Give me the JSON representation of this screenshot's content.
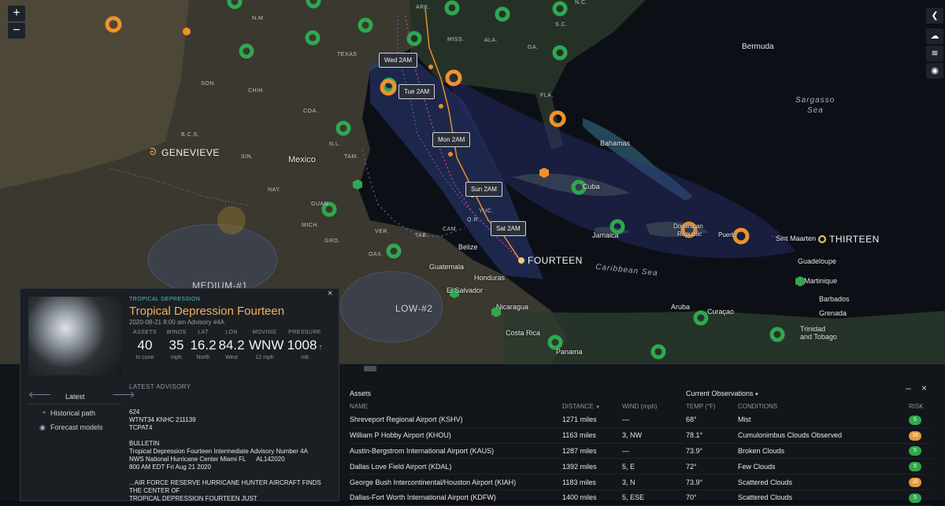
{
  "map": {
    "zoom_in": "+",
    "zoom_out": "−",
    "labels": {
      "ark": "ARK.",
      "nc": "N.C.",
      "nm": "N.M.",
      "miss": "MISS.",
      "ala": "ALA.",
      "sc": "S.C.",
      "ga": "GA.",
      "texas": "TEXAS",
      "fla": "FLA.",
      "son": "SON.",
      "chih": "CHIH.",
      "coa": "COA.",
      "bcs": "B.C.S.",
      "nl": "N.L.",
      "sin": "SIN.",
      "tam": "TAM.",
      "nay": "NAY.",
      "gro": "GRO.",
      "oax": "OAX.",
      "ver": "VER.",
      "mich": "MICH.",
      "tab": "TAB.",
      "cam": "CAM.",
      "qr": "Q.R.",
      "yuc": "YUC.",
      "gto": "GUAN.",
      "mexico": "Mexico",
      "bermuda": "Bermuda",
      "bahamas": "Bahamas",
      "cuba": "Cuba",
      "jamaica": "Jamaica",
      "dominican": "Dominican",
      "republic": "Republic",
      "puerto": "Puerto",
      "sint_maarten": "Sint Maarten",
      "guadeloupe": "Guadeloupe",
      "martinique": "Martinique",
      "barbados": "Barbados",
      "grenada": "Grenada",
      "trinidad": "Trinidad",
      "and_tobago": "and Tobago",
      "aruba": "Aruba",
      "curacao": "Curaçao",
      "belize": "Belize",
      "guatemala": "Guatemala",
      "honduras": "Honduras",
      "el_salvador": "El Salvador",
      "nicaragua": "Nicaragua",
      "costa_rica": "Costa Rica",
      "panama": "Panama",
      "sargasso": "Sargasso",
      "sea": "Sea",
      "caribbean": "Caribbean Sea"
    },
    "storms": {
      "genevieve": "GENEVIEVE",
      "thirteen": "THIRTEEN",
      "fourteen": "FOURTEEN",
      "medium1": "MEDIUM-#1",
      "low2": "LOW-#2"
    },
    "track_times": [
      "Wed 2AM",
      "Tue 2AM",
      "Mon 2AM",
      "Sun 2AM",
      "Sat 2AM"
    ],
    "colors": {
      "green": "#2fa84f",
      "orange": "#f0922c",
      "track_orange": "#e98d2a",
      "track_pink": "#d5468f"
    }
  },
  "storm_panel": {
    "category": "TROPICAL DEPRESSION",
    "title": "Tropical Depression Fourteen",
    "subtitle": "2020-08-21 8:00 am Advisory #4A",
    "stats": [
      {
        "head": "ASSETS",
        "value": "40",
        "unit": "In cone"
      },
      {
        "head": "WINDS",
        "value": "35",
        "unit": "mph"
      },
      {
        "head": "LAT",
        "value": "16.2",
        "unit": "North"
      },
      {
        "head": "LON",
        "value": "84.2",
        "unit": "West"
      },
      {
        "head": "MOVING",
        "value": "WNW",
        "unit": "12 mph"
      },
      {
        "head": "PRESSURE",
        "value": "1008",
        "unit": "mb"
      }
    ],
    "pressure_trend": "↑",
    "nav": {
      "prev": "🡐",
      "label": "Latest",
      "next": "🡒"
    },
    "historical": "Historical path",
    "forecast": "Forecast models",
    "advisory_head": "LATEST ADVISORY",
    "advisory_lines": [
      "624",
      "WTNT34 KNHC 211139",
      "TCPAT4",
      "",
      "BULLETIN",
      "Tropical Depression Fourteen Intermediate Advisory Number 4A",
      "NWS National Hurricane Center Miami FL      AL142020",
      "800 AM EDT Fri Aug 21 2020",
      "",
      "...AIR FORCE RESERVE HURRICANE HUNTER AIRCRAFT FINDS THE CENTER OF",
      "TROPICAL DEPRESSION FOURTEEN JUST"
    ],
    "close": "×"
  },
  "assets": {
    "title": "Assets",
    "obs_title": "Current Observations",
    "columns": [
      "NAME",
      "DISTANCE",
      "WIND (mph)",
      "TEMP (°F)",
      "CONDITIONS",
      "RISK"
    ],
    "rows": [
      {
        "name": "Shreveport Regional Airport (KSHV)",
        "distance": "1271 miles",
        "wind": "—",
        "temp": "68°",
        "conditions": "Mist",
        "risk": "5",
        "risk_color": "#2fa84f"
      },
      {
        "name": "William P Hobby Airport (KHOU)",
        "distance": "1163 miles",
        "wind": "3, NW",
        "temp": "78.1°",
        "conditions": "Cumulonimbus Clouds Observed",
        "risk": "16",
        "risk_color": "#e59a3a"
      },
      {
        "name": "Austin-Bergstrom International Airport (KAUS)",
        "distance": "1287 miles",
        "wind": "—",
        "temp": "73.9°",
        "conditions": "Broken Clouds",
        "risk": "5",
        "risk_color": "#2fa84f"
      },
      {
        "name": "Dallas Love Field Airport (KDAL)",
        "distance": "1392 miles",
        "wind": "5, E",
        "temp": "72°",
        "conditions": "Few Clouds",
        "risk": "5",
        "risk_color": "#2fa84f"
      },
      {
        "name": "George Bush Intercontinental/Houston Airport (KIAH)",
        "distance": "1183 miles",
        "wind": "3, N",
        "temp": "73.9°",
        "conditions": "Scattered Clouds",
        "risk": "16",
        "risk_color": "#e59a3a"
      },
      {
        "name": "Dallas-Fort Worth International Airport (KDFW)",
        "distance": "1400 miles",
        "wind": "5, ESE",
        "temp": "70°",
        "conditions": "Scattered Clouds",
        "risk": "5",
        "risk_color": "#2fa84f"
      }
    ],
    "minimize": "–",
    "close": "×"
  }
}
